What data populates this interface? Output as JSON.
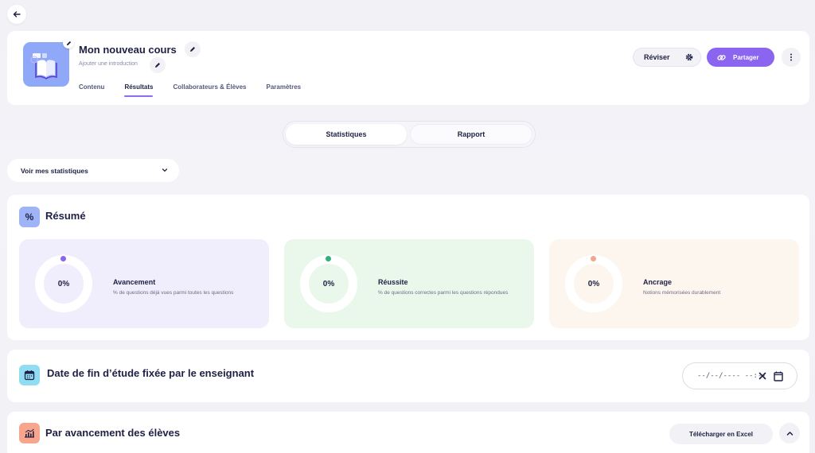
{
  "header": {
    "course_title": "Mon nouveau cours",
    "intro_placeholder": "Ajouter une introduction",
    "tabs": [
      {
        "label": "Contenu",
        "active": false
      },
      {
        "label": "Résultats",
        "active": true
      },
      {
        "label": "Collaborateurs & Élèves",
        "active": false
      },
      {
        "label": "Paramètres",
        "active": false
      }
    ],
    "reviser_label": "Réviser",
    "share_label": "Partager"
  },
  "view_switch": {
    "options": [
      "Statistiques",
      "Rapport"
    ],
    "selected": "Statistiques"
  },
  "stats_select": {
    "value": "Voir mes statistiques"
  },
  "summary": {
    "icon_text": "%",
    "title": "Résumé",
    "metrics": [
      {
        "value": "0%",
        "title": "Avancement",
        "description": "% de questions déjà vues parmi toutes les questions"
      },
      {
        "value": "0%",
        "title": "Réussite",
        "description": "% de questions correctes parmi les questions répondues"
      },
      {
        "value": "0%",
        "title": "Ancrage",
        "description": "Notions mémorisées durablement"
      }
    ]
  },
  "deadline": {
    "title": "Date de fin d’étude fixée par le enseignant",
    "date_placeholder": "--/--/---- --:--"
  },
  "progress_section": {
    "title": "Par avancement des élèves",
    "download_label": "Télécharger en Excel"
  },
  "colors": {
    "accent": "#8b64f0",
    "avancement_bg": "#f0edfd",
    "avancement_dot": "#8b64f0",
    "reussite_bg": "#eaf8ec",
    "reussite_dot": "#2db37a",
    "ancrage_bg": "#fdf6ee",
    "ancrage_dot": "#f5a48f"
  }
}
